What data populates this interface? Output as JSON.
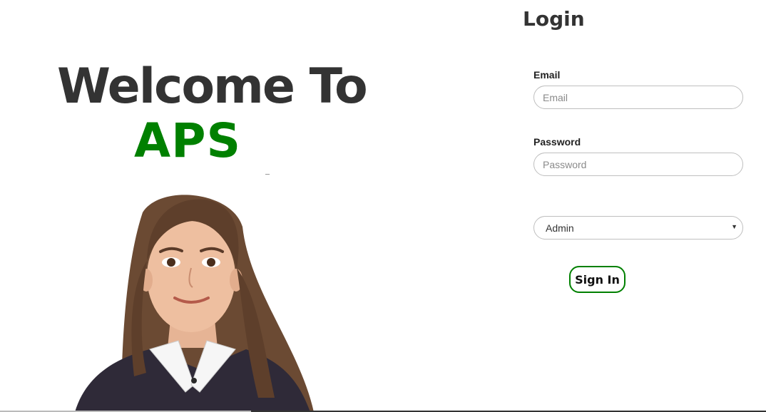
{
  "hero": {
    "welcome_text": "Welcome To",
    "brand_text": "APS",
    "photo": "student-photo"
  },
  "login": {
    "title": "Login",
    "email": {
      "label": "Email",
      "placeholder": "Email",
      "value": ""
    },
    "password": {
      "label": "Password",
      "placeholder": "Password",
      "value": ""
    },
    "role": {
      "selected": "Admin"
    },
    "sign_in_label": "Sign In"
  },
  "colors": {
    "brand_green": "#008000",
    "heading": "#333333",
    "input_border": "#bfbfbf"
  }
}
